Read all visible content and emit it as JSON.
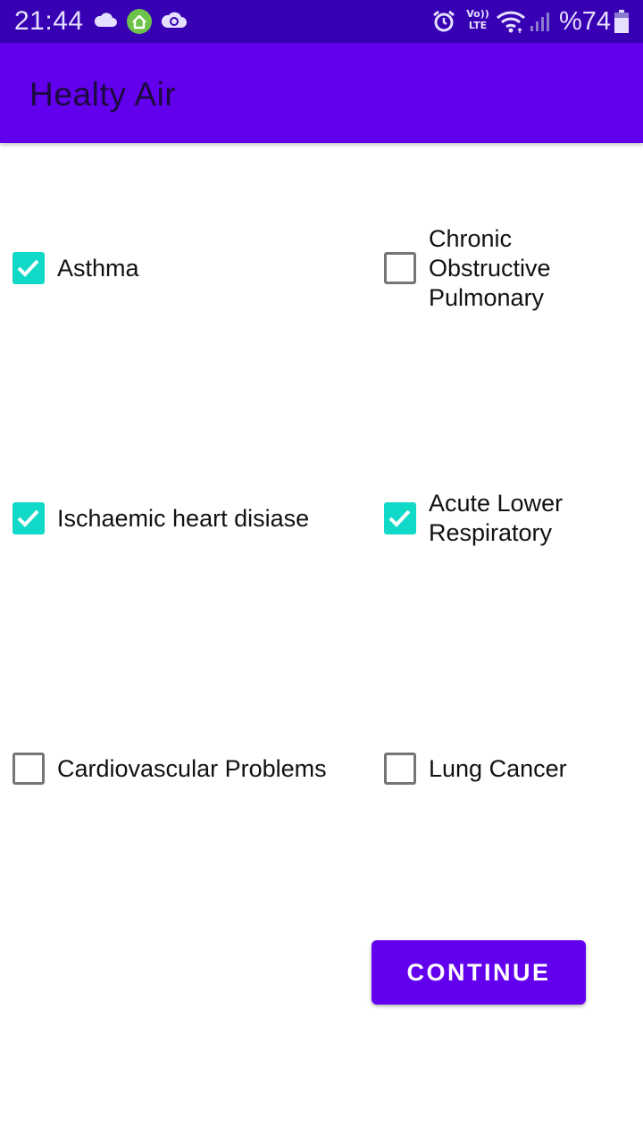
{
  "status_bar": {
    "time": "21:44",
    "battery": "%74",
    "icons": [
      "cloud-icon",
      "home-app-icon",
      "cloud-sync-icon",
      "alarm-icon",
      "volte-icon",
      "wifi-icon",
      "signal-icon",
      "battery-icon"
    ],
    "network_label_top": "Vo))",
    "network_label_bottom": "LTE"
  },
  "app_bar": {
    "title": "Healty Air"
  },
  "options": [
    {
      "label": "Asthma",
      "checked": true
    },
    {
      "label": "Chronic\nObstructive\nPulmonary",
      "checked": false
    },
    {
      "label": "Ischaemic heart disiase",
      "checked": true
    },
    {
      "label": "Acute Lower\nRespiratory",
      "checked": true
    },
    {
      "label": "Cardiovascular Problems",
      "checked": false
    },
    {
      "label": "Lung Cancer",
      "checked": false
    }
  ],
  "continue_button": {
    "label": "CONTINUE"
  },
  "colors": {
    "status_bar": "#3700B3",
    "app_bar": "#6200EE",
    "checkbox_checked": "#10D9C8",
    "checkbox_unchecked_border": "#757575",
    "button": "#6200EE"
  }
}
